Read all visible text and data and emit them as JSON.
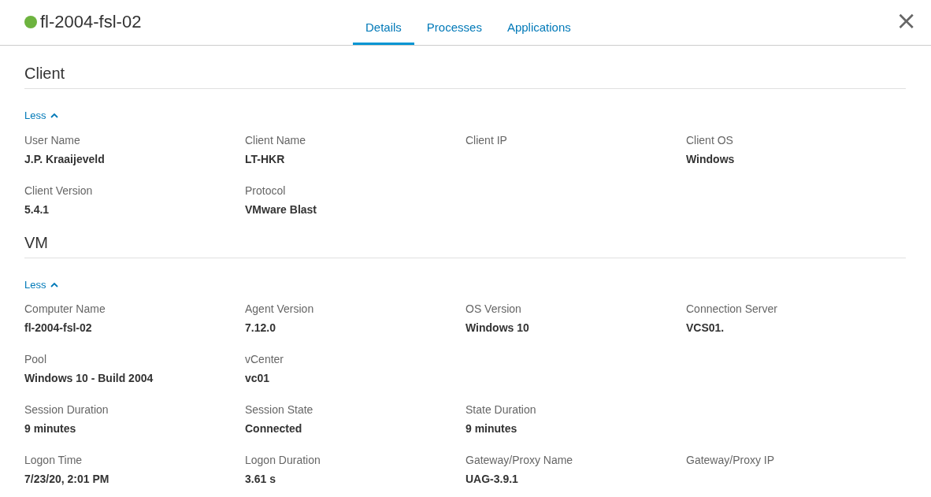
{
  "header": {
    "online": true,
    "title": "fl-2004-fsl-02",
    "close": "×"
  },
  "tabs": [
    {
      "label": "Details",
      "selected": true
    },
    {
      "label": "Processes",
      "selected": false
    },
    {
      "label": "Applications",
      "selected": false
    }
  ],
  "sections": [
    {
      "title": "Client",
      "toggle": "Less",
      "expanded": true,
      "rows": [
        [
          {
            "label": "User Name",
            "value": "J.P. Kraaijeveld"
          },
          {
            "label": "Client Name",
            "value": "LT-HKR"
          },
          {
            "label": "Client IP"
          },
          {
            "label": "Client OS",
            "value": "Windows"
          }
        ],
        [
          {
            "label": "Client Version",
            "value": "5.4.1"
          },
          {
            "label": "Protocol",
            "value": "VMware Blast"
          }
        ]
      ]
    },
    {
      "title": "VM",
      "toggle": "Less",
      "expanded": true,
      "rows": [
        [
          {
            "label": "Computer Name",
            "value": "fl-2004-fsl-02"
          },
          {
            "label": "Agent Version",
            "value": "7.12.0"
          },
          {
            "label": "OS Version",
            "value": "Windows 10"
          },
          {
            "label": "Connection Server",
            "value": "VCS01."
          }
        ],
        [
          {
            "label": "Pool",
            "value": "Windows 10 - Build 2004"
          },
          {
            "label": "vCenter",
            "value": "vc01"
          }
        ],
        [
          {
            "label": "Session Duration",
            "value": "9 minutes"
          },
          {
            "label": "Session State",
            "value": "Connected"
          },
          {
            "label": "State Duration",
            "value": "9 minutes"
          }
        ],
        [
          {
            "label": "Logon Time",
            "value": "7/23/20, 2:01 PM"
          },
          {
            "label": "Logon Duration",
            "value": "3.61 s"
          },
          {
            "label": "Gateway/Proxy Name",
            "value": "UAG-3.9.1"
          },
          {
            "label": "Gateway/Proxy IP"
          }
        ]
      ]
    }
  ]
}
